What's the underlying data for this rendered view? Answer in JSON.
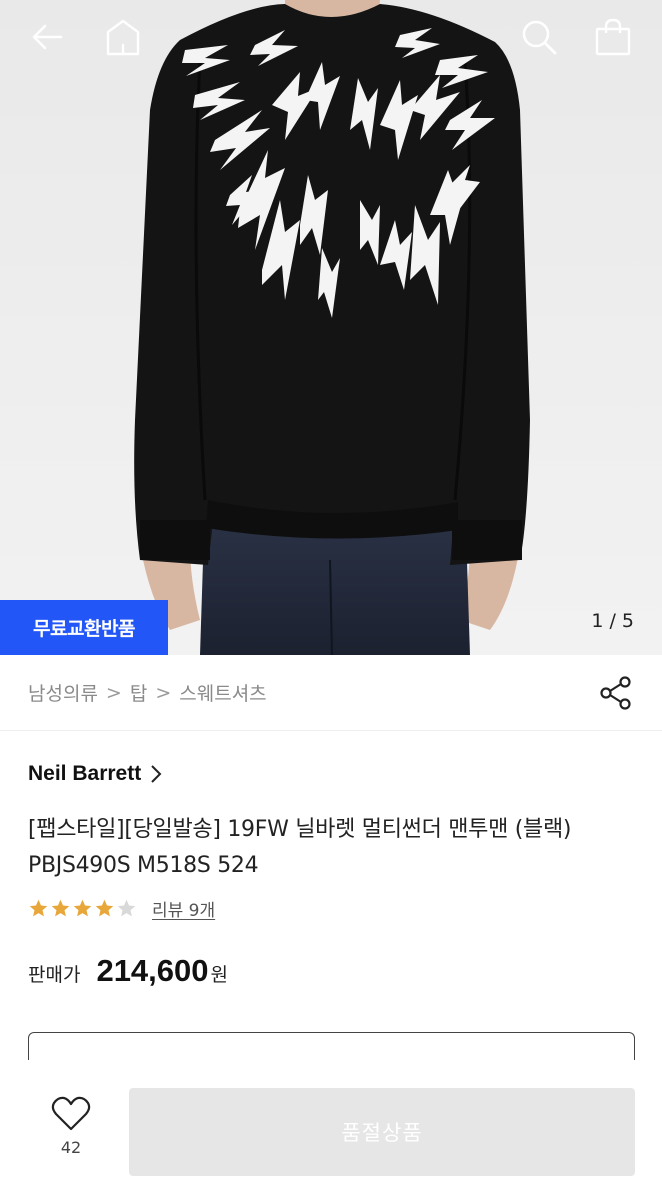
{
  "hero": {
    "badge": "무료교환반품",
    "pager": "1 / 5"
  },
  "topbar": {
    "icons": [
      "back-arrow-icon",
      "home-icon",
      "search-icon",
      "shopping-bag-icon"
    ]
  },
  "breadcrumb": {
    "items": [
      "남성의류",
      "탑",
      "스웨트셔츠"
    ],
    "separator": ">"
  },
  "product": {
    "brand": "Neil Barrett",
    "title": "[팹스타일][당일발송] 19FW 닐바렛 멀티썬더 맨투맨 (블랙) PBJS490S M518S 524",
    "rating": 4,
    "rating_max": 5,
    "review_label": "리뷰 9개",
    "price_label": "판매가",
    "price": "214,600",
    "price_unit": "원"
  },
  "bottom": {
    "wish_count": "42",
    "soldout_label": "품절상품"
  },
  "colors": {
    "accent_blue": "#2356f6",
    "star_filled": "#e8a73a",
    "star_empty": "#d9d9d9",
    "soldout_bg": "#e6e6e6"
  }
}
